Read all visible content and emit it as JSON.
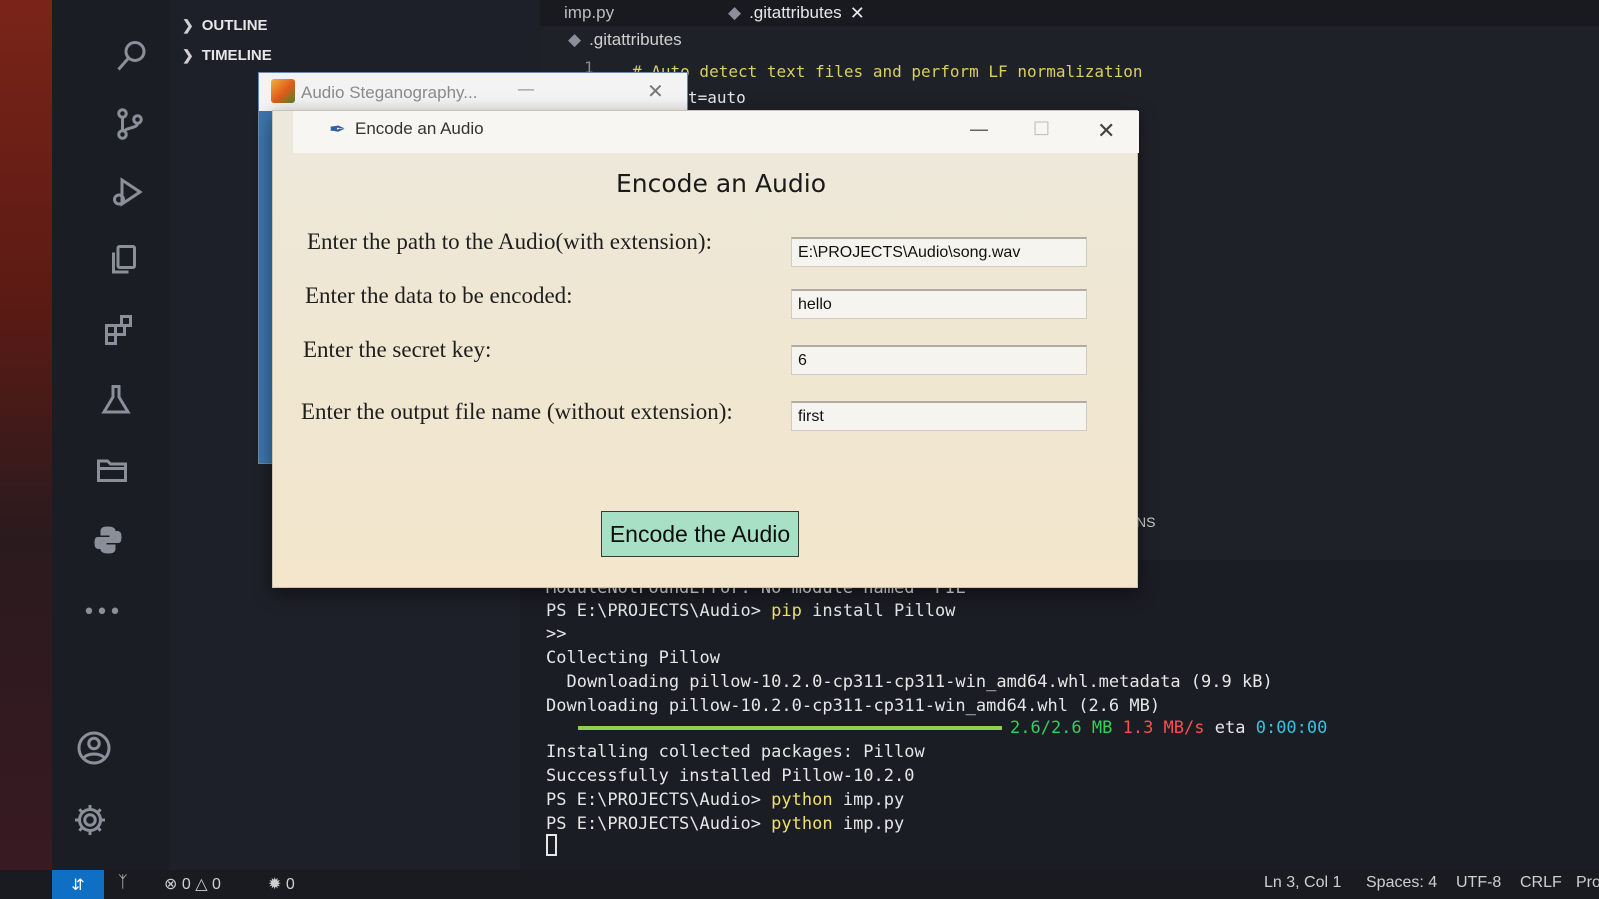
{
  "explorer": {
    "outline_label": "OUTLINE",
    "timeline_label": "TIMELINE"
  },
  "editor": {
    "tabs": [
      {
        "label": "imp.py"
      },
      {
        "label": ".gitattributes"
      }
    ],
    "breadcrumb": ".gitattributes",
    "lines": [
      {
        "number": "1",
        "text": "# Auto detect text files and perform LF normalization"
      },
      {
        "number": "",
        "text": "t=auto"
      }
    ]
  },
  "panel": {
    "partial_tab_label": "NS",
    "terminal_lines": [
      {
        "text": "ModuleNotFoundError: No module named 'PIL'"
      },
      {
        "prompt": "PS E:\\PROJECTS\\Audio> ",
        "cmd": "pip",
        "args": " install Pillow"
      },
      {
        "text": ">>"
      },
      {
        "text": "Collecting Pillow"
      },
      {
        "text": "  Downloading pillow-10.2.0-cp311-cp311-win_amd64.whl.metadata (9.9 kB)"
      },
      {
        "text": "Downloading pillow-10.2.0-cp311-cp311-win_amd64.whl (2.6 MB)"
      },
      {
        "text": "Installing collected packages: Pillow"
      },
      {
        "text": "Successfully installed Pillow-10.2.0"
      },
      {
        "prompt": "PS E:\\PROJECTS\\Audio> ",
        "cmd": "python",
        "args": " imp.py"
      },
      {
        "prompt": "PS E:\\PROJECTS\\Audio> ",
        "cmd": "python",
        "args": " imp.py"
      }
    ],
    "download_progress": {
      "fraction": 1.0,
      "size_text": "2.6/2.6 MB",
      "speed_text": "1.3 MB/s",
      "eta_label": "eta",
      "eta_value": "0:00:00"
    }
  },
  "status_bar": {
    "errors": "0",
    "warnings": "0",
    "ports": "0",
    "position": "Ln 3, Col 1",
    "spaces": "Spaces: 4",
    "encoding": "UTF-8",
    "eol": "CRLF",
    "partial_item": "Pro"
  },
  "background_window": {
    "title": "Audio Steganography..."
  },
  "dialog": {
    "window_title": "Encode an Audio",
    "heading": "Encode an Audio",
    "fields": [
      {
        "label": "Enter the path to the Audio(with extension):",
        "value": "E:\\PROJECTS\\Audio\\song.wav"
      },
      {
        "label": "Enter the data to be encoded:",
        "value": "hello"
      },
      {
        "label": "Enter the secret key:",
        "value": "6"
      },
      {
        "label": "Enter the output file name (without extension):",
        "value": "first"
      }
    ],
    "submit_label": "Encode the Audio"
  },
  "colors": {
    "remote_button": "#0e6fc5",
    "encode_button": "#a8e0c6",
    "progress_bar": "#8fd14f"
  }
}
